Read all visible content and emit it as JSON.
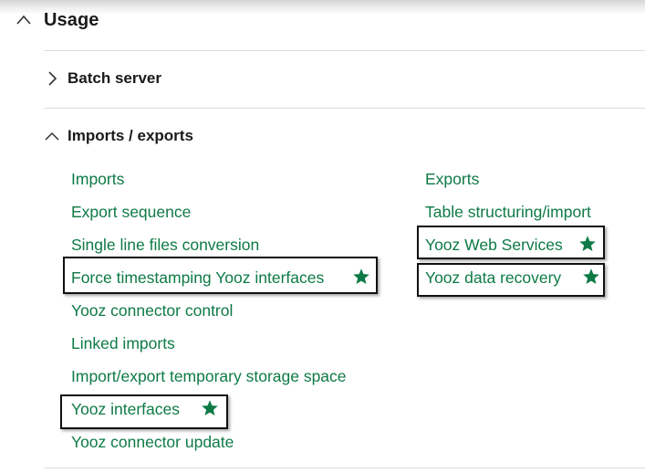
{
  "usage": {
    "title": "Usage",
    "chevron": "chevron-up-icon"
  },
  "batch_server": {
    "title": "Batch server",
    "chevron": "chevron-right-icon"
  },
  "imports_exports": {
    "title": "Imports / exports",
    "chevron": "chevron-up-icon",
    "left_links": [
      {
        "label": "Imports",
        "highlighted": false,
        "favorite": false
      },
      {
        "label": "Export sequence",
        "highlighted": false,
        "favorite": false
      },
      {
        "label": "Single line files conversion",
        "highlighted": false,
        "favorite": false
      },
      {
        "label": "Force timestamping Yooz interfaces",
        "highlighted": true,
        "favorite": true
      },
      {
        "label": "Yooz connector control",
        "highlighted": false,
        "favorite": false
      },
      {
        "label": "Linked imports",
        "highlighted": false,
        "favorite": false
      },
      {
        "label": "Import/export temporary storage space",
        "highlighted": false,
        "favorite": false
      },
      {
        "label": "Yooz interfaces",
        "highlighted": true,
        "favorite": true
      },
      {
        "label": "Yooz connector update",
        "highlighted": false,
        "favorite": false
      }
    ],
    "right_links": [
      {
        "label": "Exports",
        "highlighted": false,
        "favorite": false
      },
      {
        "label": "Table structuring/import",
        "highlighted": false,
        "favorite": false
      },
      {
        "label": "Yooz Web Services",
        "highlighted": true,
        "favorite": true
      },
      {
        "label": "Yooz data recovery",
        "highlighted": true,
        "favorite": true
      }
    ]
  },
  "colors": {
    "link": "#0e7a46",
    "star": "#0e7a46",
    "highlight_border": "#111111"
  }
}
